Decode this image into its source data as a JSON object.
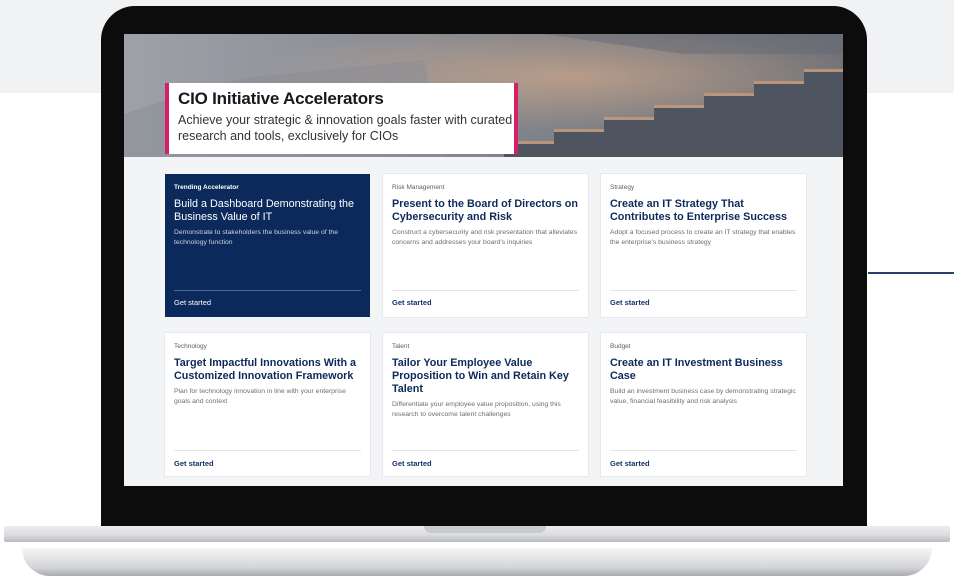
{
  "hero": {
    "title": "CIO Initiative Accelerators",
    "subtitle": "Achieve your strategic & innovation goals faster with curated research and tools, exclusively for CIOs"
  },
  "cards": [
    {
      "category": "Trending Accelerator",
      "title": "Build a Dashboard Demonstrating the Business Value of IT",
      "description": "Demonstrate to stakeholders the business value of the technology function",
      "cta": "Get started"
    },
    {
      "category": "Risk Management",
      "title": "Present to the Board of Directors on Cybersecurity and Risk",
      "description": "Construct a cybersecurity and risk presentation that alleviates concerns and addresses your board's inquiries",
      "cta": "Get started"
    },
    {
      "category": "Strategy",
      "title": "Create an IT Strategy That Contributes to Enterprise Success",
      "description": "Adopt a focused process to create an IT strategy that enables the enterprise's business strategy",
      "cta": "Get started"
    },
    {
      "category": "Technology",
      "title": "Target Impactful Innovations With a Customized Innovation Framework",
      "description": "Plan for technology innovation in line with your enterprise goals and context",
      "cta": "Get started"
    },
    {
      "category": "Talent",
      "title": "Tailor Your Employee Value Proposition to Win and Retain Key Talent",
      "description": "Differentiate your employee value proposition, using this research to overcome talent challenges",
      "cta": "Get started"
    },
    {
      "category": "Budget",
      "title": "Create an IT Investment Business Case",
      "description": "Build an investment business case by demonstrating strategic value, financial feasibility and risk analysis",
      "cta": "Get started"
    }
  ],
  "colors": {
    "featured_card": "#0b2a5b",
    "accent_border": "#d61f69",
    "link": "#16316a"
  }
}
